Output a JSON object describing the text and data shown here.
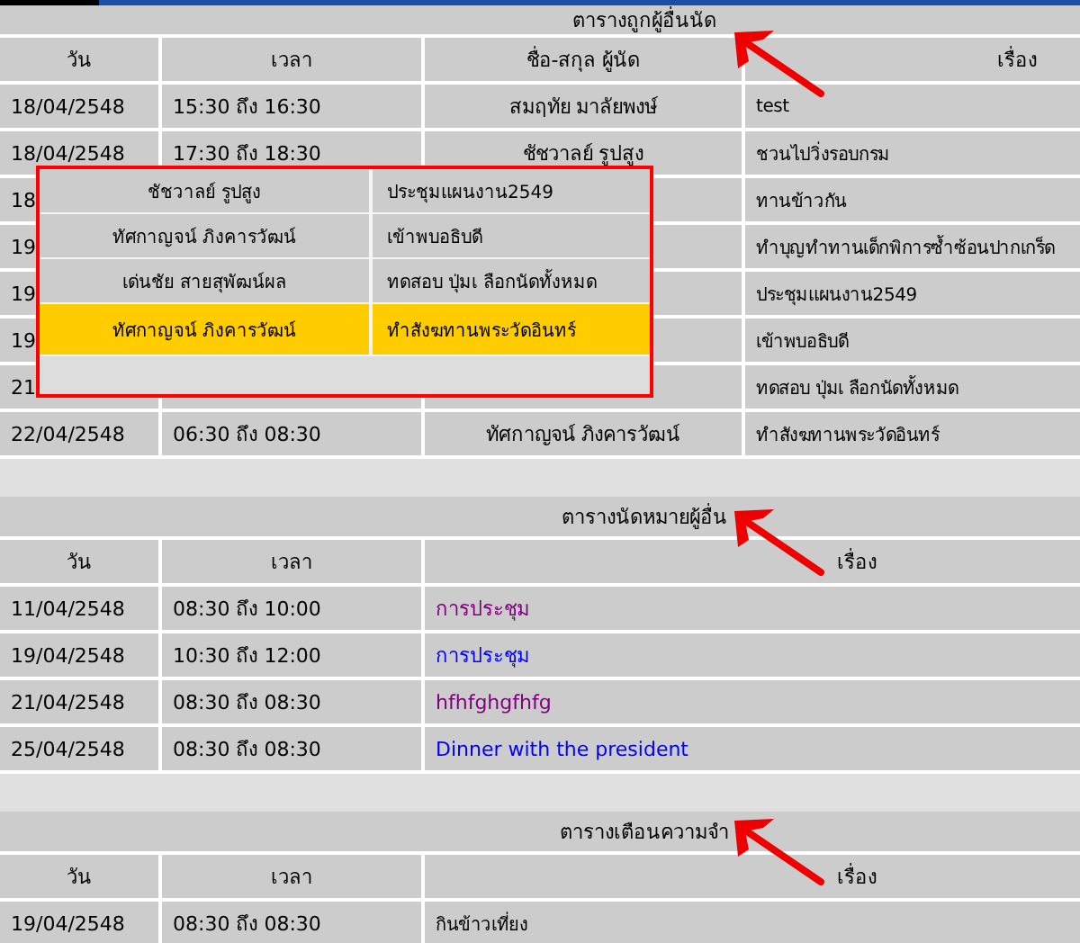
{
  "sections": [
    {
      "title": "ตารางถูกผู้อื่นนัด",
      "columns": [
        "วัน",
        "เวลา",
        "ชื่อ-สกุล ผู้นัด",
        "เรื่อง"
      ],
      "rows": [
        {
          "date": "18/04/2548",
          "time": "15:30 ถึง 16:30",
          "name": "สมฤทัย มาลัยพงษ์",
          "topic": "test"
        },
        {
          "date": "18/04/2548",
          "time": "17:30 ถึง 18:30",
          "name": "ชัชวาลย์ รูปสูง",
          "topic": "ชวนไปวิ่งรอบกรม"
        },
        {
          "date": "18",
          "topic": "ทานข้าวกัน"
        },
        {
          "date": "19",
          "topic": "ทำบุญทำทานเด็กพิการซ้ำซ้อนปากเกร็ด"
        },
        {
          "date": "19",
          "topic": "ประชุมแผนงาน2549"
        },
        {
          "date": "19",
          "topic": "เข้าพบอธิบดี"
        },
        {
          "date": "21",
          "topic": "ทดสอบ ปุ่มเ ลือกนัดทั้งหมด"
        },
        {
          "date": "22/04/2548",
          "time": "06:30 ถึง 08:30",
          "name": "ทัศกาญจน์ ภิงคารวัฒน์",
          "topic": "ทำสังฆทานพระวัดอินทร์"
        }
      ]
    },
    {
      "title": "ตารางนัดหมายผู้อื่น",
      "columns": [
        "วัน",
        "เวลา",
        "เรื่อง"
      ],
      "rows": [
        {
          "date": "11/04/2548",
          "time": "08:30 ถึง 10:00",
          "topic": "การประชุม",
          "color": "#800080"
        },
        {
          "date": "19/04/2548",
          "time": "10:30 ถึง 12:00",
          "topic": "การประชุม",
          "color": "#0000ff"
        },
        {
          "date": "21/04/2548",
          "time": "08:30 ถึง 08:30",
          "topic": "hfhfghgfhfg",
          "color": "#800080"
        },
        {
          "date": "25/04/2548",
          "time": "08:30 ถึง 08:30",
          "topic": "Dinner with the president",
          "color": "#0000ff"
        }
      ]
    },
    {
      "title": "ตารางเตือนความจำ",
      "columns": [
        "วัน",
        "เวลา",
        "เรื่อง"
      ],
      "rows": [
        {
          "date": "19/04/2548",
          "time": "08:30 ถึง 08:30",
          "topic": "กินข้าวเที่ยง"
        }
      ]
    }
  ],
  "popup": {
    "rows": [
      {
        "name": "ชัชวาลย์ รูปสูง",
        "topic": "ประชุมแผนงาน2549",
        "selected": false
      },
      {
        "name": "ทัศกาญจน์ ภิงคารวัฒน์",
        "topic": "เข้าพบอธิบดี",
        "selected": false
      },
      {
        "name": "เด่นชัย สายสุพัฒน์ผล",
        "topic": "ทดสอบ ปุ่มเ ลือกนัดทั้งหมด",
        "selected": false
      },
      {
        "name": "ทัศกาญจน์ ภิงคารวัฒน์",
        "topic": "ทำสังฆทานพระวัดอินทร์",
        "selected": true
      }
    ]
  }
}
